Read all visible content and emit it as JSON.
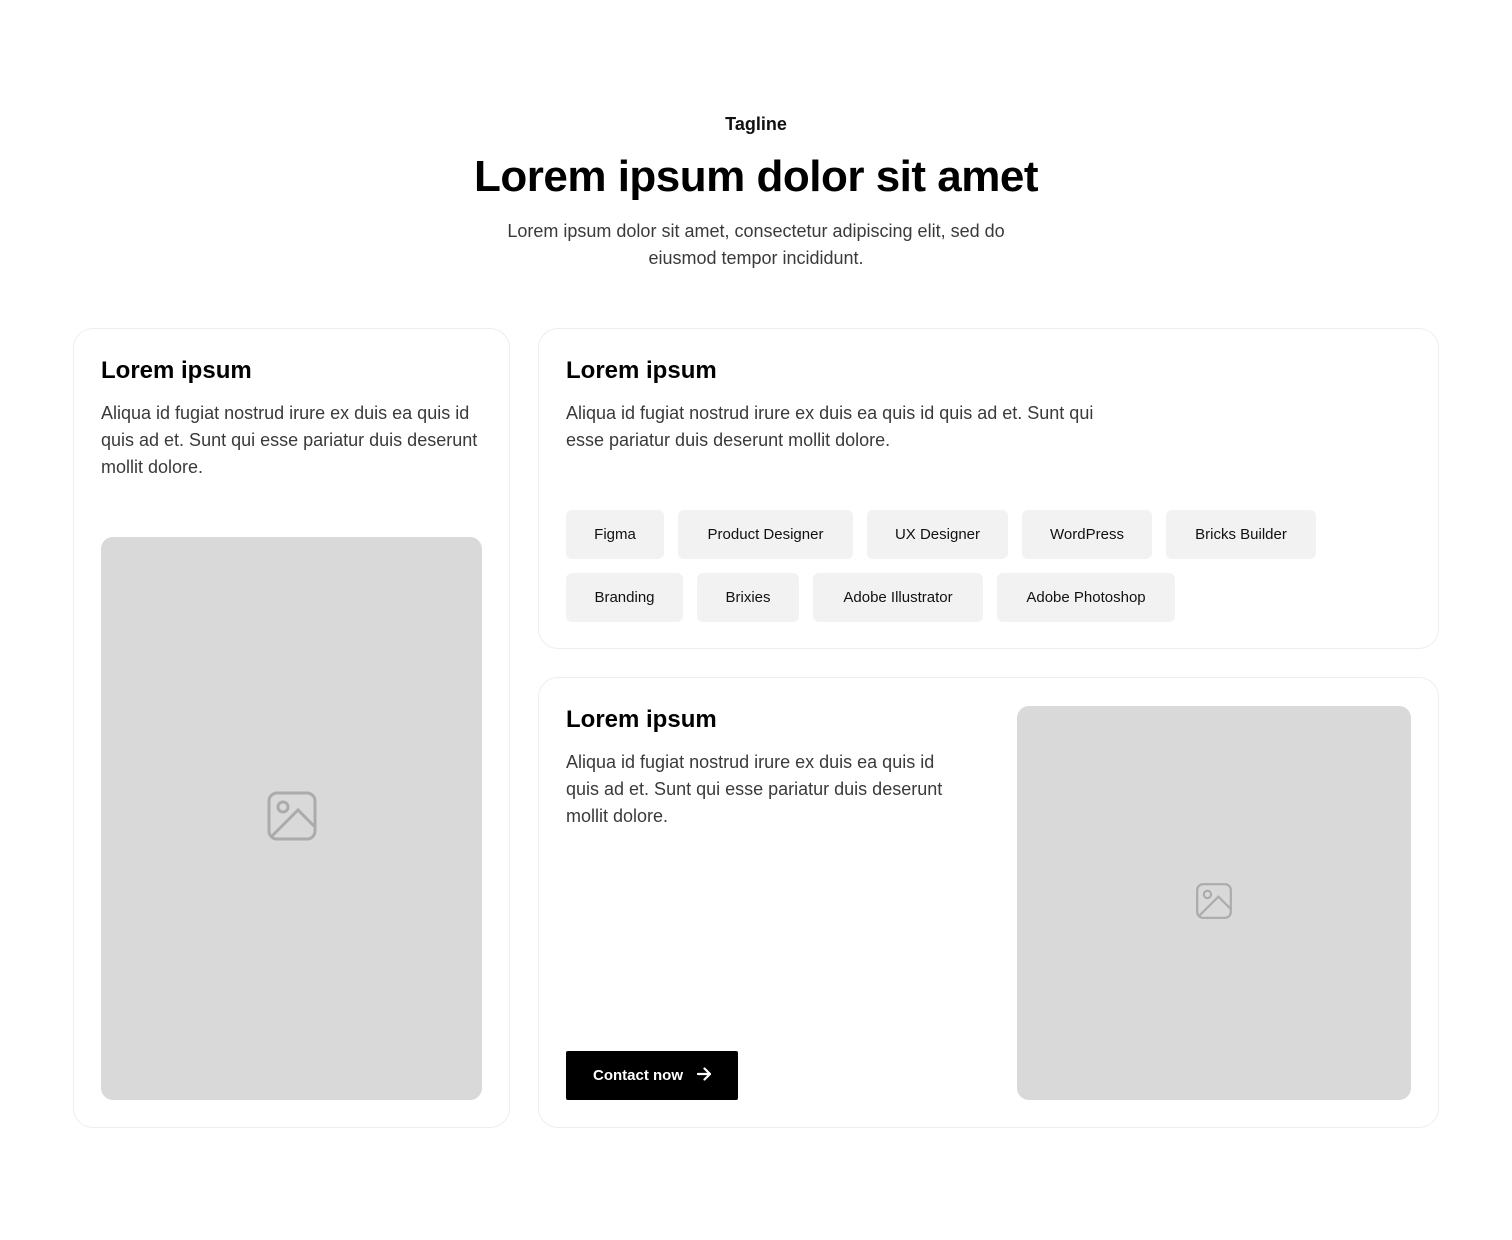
{
  "header": {
    "tagline": "Tagline",
    "title": "Lorem ipsum dolor sit amet",
    "subtitle": "Lorem ipsum dolor sit amet, consectetur adipiscing elit, sed do eiusmod tempor incididunt."
  },
  "card_left": {
    "title": "Lorem ipsum",
    "text": "Aliqua id fugiat nostrud irure ex duis ea quis id quis ad et. Sunt qui esse pariatur duis deserunt mollit dolore.",
    "image_icon": "image-icon"
  },
  "card_top_right": {
    "title": "Lorem ipsum",
    "text": "Aliqua id fugiat nostrud irure ex duis ea quis id quis ad et. Sunt qui esse pariatur duis deserunt mollit dolore.",
    "tags": [
      "Figma",
      "Product Designer",
      "UX Designer",
      "WordPress",
      "Bricks Builder",
      "Branding",
      "Brixies",
      "Adobe Illustrator",
      "Adobe Photoshop"
    ]
  },
  "card_bottom_right": {
    "title": "Lorem ipsum",
    "text": "Aliqua id fugiat nostrud irure ex duis ea quis id quis ad et. Sunt qui esse pariatur duis deserunt mollit dolore.",
    "button_label": "Contact now",
    "button_icon": "arrow-right-icon",
    "image_icon": "image-icon"
  },
  "colors": {
    "placeholder": "#d9d9d9",
    "tag_bg": "#f2f2f2",
    "button_bg": "#000000"
  }
}
